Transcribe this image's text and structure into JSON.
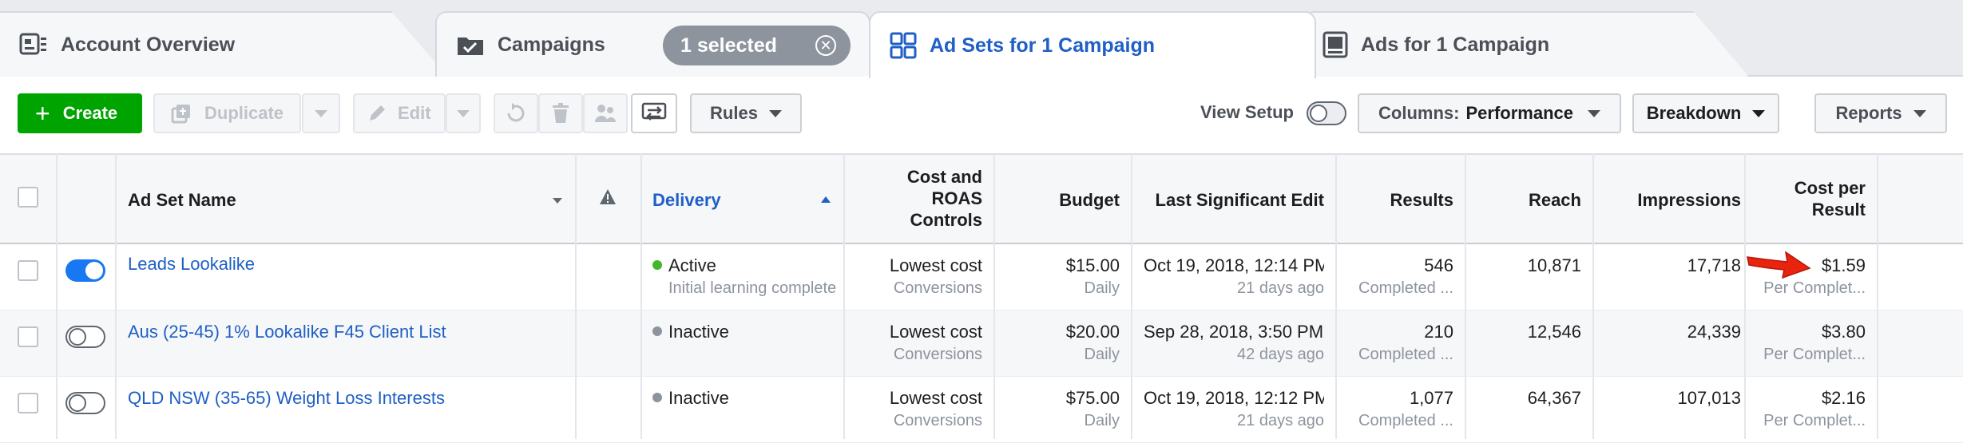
{
  "tabs": {
    "account": "Account Overview",
    "campaigns": "Campaigns",
    "selected_badge": "1 selected",
    "adsets": "Ad Sets for 1 Campaign",
    "ads": "Ads for 1 Campaign"
  },
  "toolbar": {
    "create": "Create",
    "duplicate": "Duplicate",
    "edit": "Edit",
    "rules": "Rules",
    "view_setup": "View Setup",
    "columns_label": "Columns:",
    "columns_value": "Performance",
    "breakdown": "Breakdown",
    "reports": "Reports"
  },
  "columns": {
    "name": "Ad Set Name",
    "delivery": "Delivery",
    "cost_controls_1": "Cost and",
    "cost_controls_2": "ROAS",
    "cost_controls_3": "Controls",
    "budget": "Budget",
    "last_edit": "Last Significant Edit",
    "results": "Results",
    "reach": "Reach",
    "impressions": "Impressions",
    "cpr_1": "Cost per",
    "cpr_2": "Result"
  },
  "rows": [
    {
      "name": "Leads Lookalike",
      "status": "Active",
      "status_sub": "Initial learning complete",
      "status_color": "#42b72a",
      "toggle": "on",
      "bid": "Lowest cost",
      "bid_sub": "Conversions",
      "budget": "$15.00",
      "budget_sub": "Daily",
      "edit": "Oct 19, 2018, 12:14 PM",
      "edit_sub": "21 days ago",
      "results": "546",
      "results_sub": "Completed ...",
      "reach": "10,871",
      "impressions": "17,718",
      "cpr": "$1.59",
      "cpr_sub": "Per Complet..."
    },
    {
      "name": "Aus (25-45) 1% Lookalike F45 Client List",
      "status": "Inactive",
      "status_sub": "",
      "status_color": "#8d949e",
      "toggle": "off",
      "bid": "Lowest cost",
      "bid_sub": "Conversions",
      "budget": "$20.00",
      "budget_sub": "Daily",
      "edit": "Sep 28, 2018, 3:50 PM",
      "edit_sub": "42 days ago",
      "results": "210",
      "results_sub": "Completed ...",
      "reach": "12,546",
      "impressions": "24,339",
      "cpr": "$3.80",
      "cpr_sub": "Per Complet..."
    },
    {
      "name": "QLD NSW (35-65) Weight Loss Interests",
      "status": "Inactive",
      "status_sub": "",
      "status_color": "#8d949e",
      "toggle": "off",
      "bid": "Lowest cost",
      "bid_sub": "Conversions",
      "budget": "$75.00",
      "budget_sub": "Daily",
      "edit": "Oct 19, 2018, 12:12 PM",
      "edit_sub": "21 days ago",
      "results": "1,077",
      "results_sub": "Completed ...",
      "reach": "64,367",
      "impressions": "107,013",
      "cpr": "$2.16",
      "cpr_sub": "Per Complet..."
    }
  ]
}
